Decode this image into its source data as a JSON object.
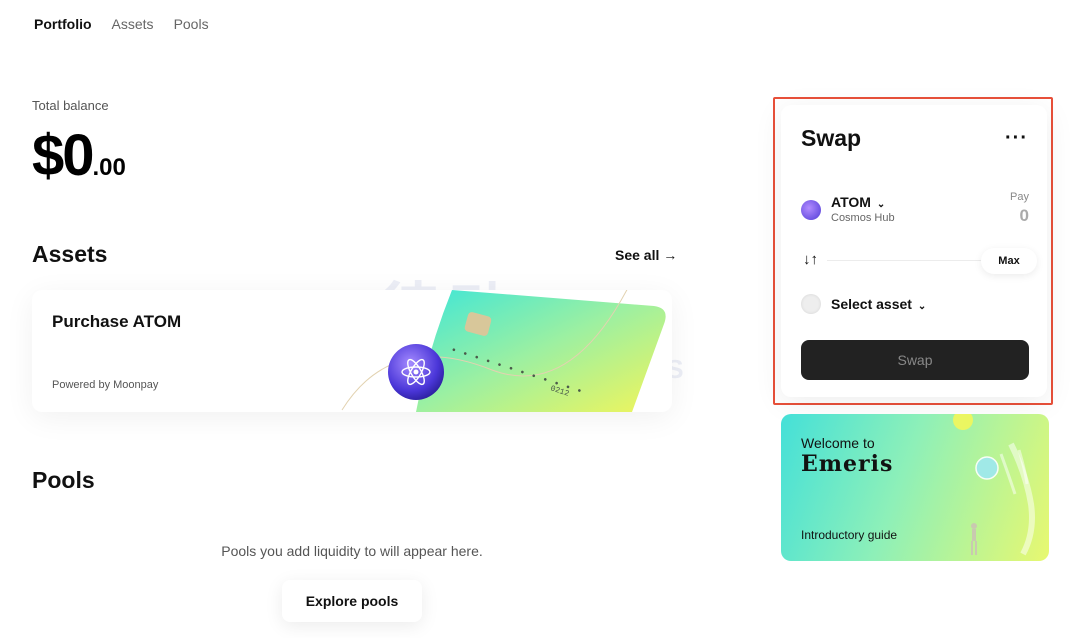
{
  "nav": {
    "items": [
      {
        "label": "Portfolio",
        "active": true
      },
      {
        "label": "Assets",
        "active": false
      },
      {
        "label": "Pools",
        "active": false
      }
    ]
  },
  "balance": {
    "label": "Total balance",
    "integer": "$0",
    "decimals": ".00"
  },
  "assets": {
    "title": "Assets",
    "see_all": "See all →",
    "purchase_card": {
      "title": "Purchase ATOM",
      "powered_by": "Powered by Moonpay",
      "card_number": "0212"
    }
  },
  "watermark": {
    "cn": "律动",
    "en": "BLOCKBEATS"
  },
  "pools": {
    "title": "Pools",
    "empty_text": "Pools you add liquidity to will appear here.",
    "explore_label": "Explore pools"
  },
  "swap": {
    "title": "Swap",
    "more_label": "···",
    "from_asset": {
      "symbol": "ATOM",
      "chain": "Cosmos Hub"
    },
    "pay_label": "Pay",
    "pay_value": "0",
    "direction_label": "↓↑",
    "max_label": "Max",
    "select_label": "Select asset",
    "swap_label": "Swap"
  },
  "welcome": {
    "line1": "Welcome to",
    "brand": "Emeris",
    "guide": "Introductory guide"
  },
  "colors": {
    "highlight_border": "#e8503a",
    "swap_button_bg": "#222222"
  }
}
